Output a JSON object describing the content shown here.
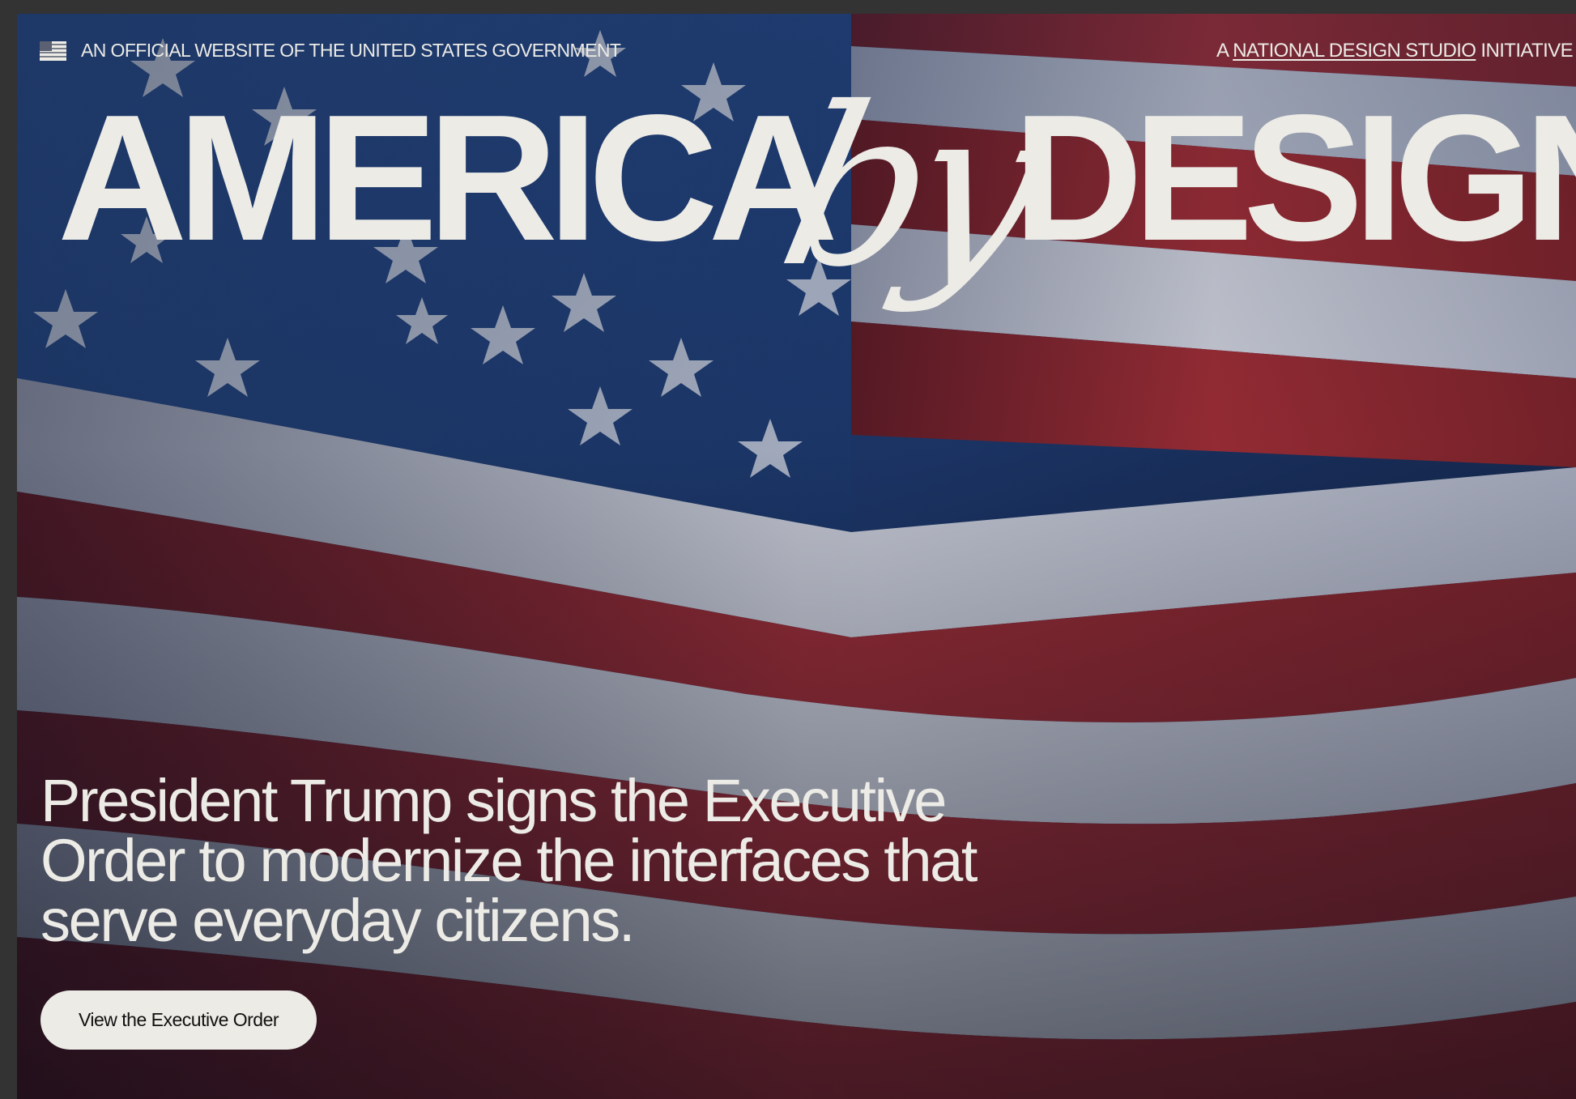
{
  "gov_banner": {
    "icon": "us-flag-icon",
    "text": "AN OFFICIAL WEBSITE OF THE UNITED STATES GOVERNMENT"
  },
  "initiative": {
    "prefix": "A ",
    "link_text": "NATIONAL DESIGN STUDIO",
    "suffix": " INITIATIVE"
  },
  "title": {
    "left": "AMERICA",
    "middle": "by",
    "right": "DESIGN"
  },
  "headline": "President Trump signs the Executive Order to modernize the interfaces that serve everyday citizens.",
  "cta": {
    "label": "View the Executive Order"
  },
  "hero_image": {
    "description_icon": "american-flag-image"
  },
  "colors": {
    "text": "#ecebe6",
    "button_bg": "#ecebe6",
    "button_text": "#111111",
    "frame": "#333333"
  }
}
